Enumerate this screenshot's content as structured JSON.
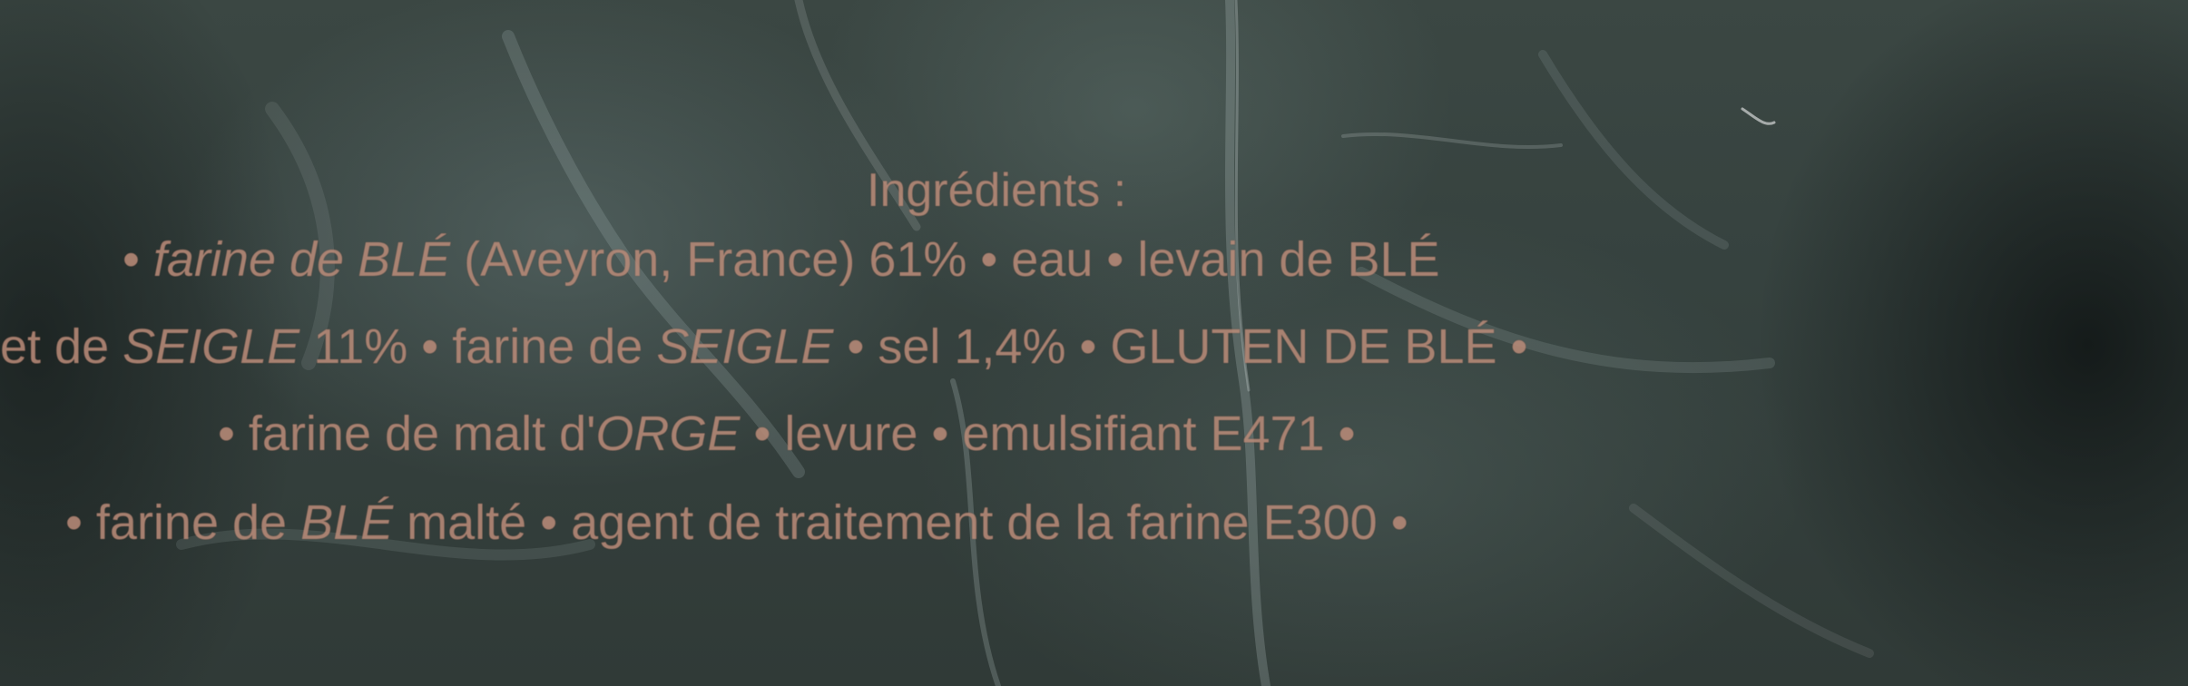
{
  "label": {
    "title": "Ingrédients :",
    "line1": {
      "a": "• ",
      "b": "farine de ",
      "c": "BLÉ",
      "d": " (Aveyron, France) 61% • eau • levain de BLÉ"
    },
    "line2": {
      "a": "et de ",
      "b": "SEIGLE",
      "c": " 11% • farine de ",
      "d": "SEIGLE",
      "e": " • sel 1,4% • GLUTEN DE BLÉ •"
    },
    "line3": {
      "a": "• farine de malt d'",
      "b": "ORGE",
      "c": " • levure • emulsifiant E471 •"
    },
    "line4": {
      "a": "• farine de ",
      "b": "BLÉ",
      "c": " malté • agent de traitement de la farine E300 •"
    }
  },
  "colors": {
    "print": "#b88a78",
    "background": "#36423f"
  }
}
